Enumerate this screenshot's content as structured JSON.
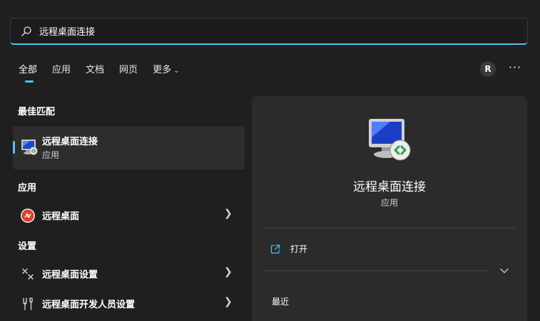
{
  "search": {
    "query": "远程桌面连接"
  },
  "tabs": [
    {
      "label": "全部"
    },
    {
      "label": "应用"
    },
    {
      "label": "文档"
    },
    {
      "label": "网页"
    },
    {
      "label": "更多"
    }
  ],
  "user": {
    "initial": "R"
  },
  "more_glyph": "···",
  "sections": {
    "best_match": "最佳匹配",
    "apps": "应用",
    "settings": "设置"
  },
  "best_match": {
    "title": "远程桌面连接",
    "subtitle": "应用"
  },
  "app_results": [
    {
      "label": "远程桌面"
    }
  ],
  "settings_results": [
    {
      "label": "远程桌面设置"
    },
    {
      "label": "远程桌面开发人员设置"
    }
  ],
  "detail": {
    "title": "远程桌面连接",
    "subtitle": "应用",
    "open_label": "打开",
    "recent_label": "最近"
  },
  "colors": {
    "accent": "#4cc2ff",
    "background": "#1f1f1f",
    "panel": "#2b2b2b"
  }
}
